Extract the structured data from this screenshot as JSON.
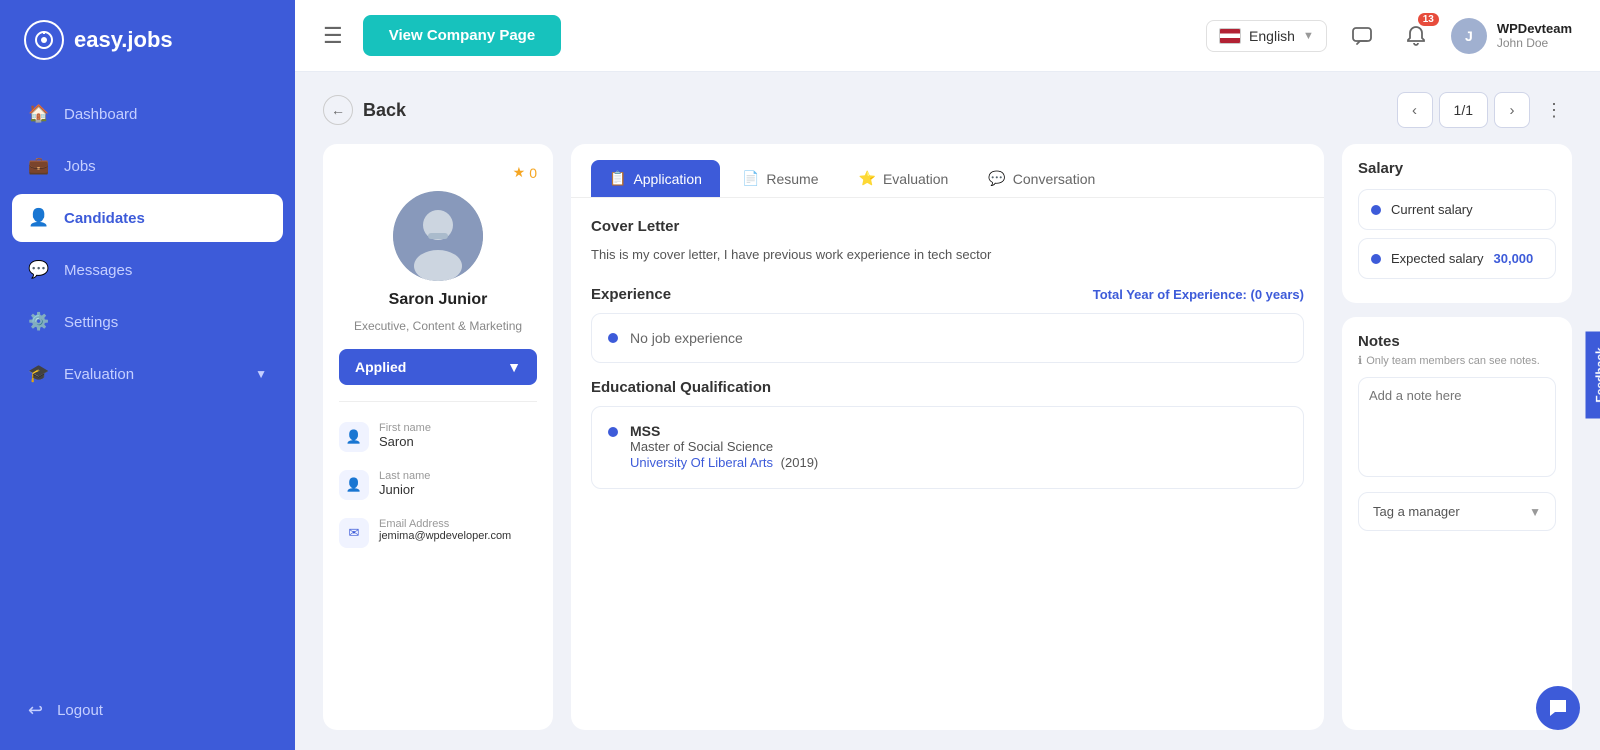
{
  "brand": {
    "name": "easy.jobs",
    "logo_char": "Q"
  },
  "sidebar": {
    "items": [
      {
        "id": "dashboard",
        "label": "Dashboard",
        "icon": "🏠"
      },
      {
        "id": "jobs",
        "label": "Jobs",
        "icon": "💼"
      },
      {
        "id": "candidates",
        "label": "Candidates",
        "icon": "👤",
        "active": true
      },
      {
        "id": "messages",
        "label": "Messages",
        "icon": "💬"
      },
      {
        "id": "settings",
        "label": "Settings",
        "icon": "⚙️"
      },
      {
        "id": "evaluation",
        "label": "Evaluation",
        "icon": "🎓",
        "has_arrow": true
      }
    ],
    "logout_label": "Logout"
  },
  "topbar": {
    "view_company_label": "View Company Page",
    "language": "English",
    "notification_count": "13",
    "user": {
      "company": "WPDevteam",
      "name": "John Doe"
    }
  },
  "back_label": "Back",
  "pagination": {
    "current": "1/1"
  },
  "candidate": {
    "name": "Saron Junior",
    "title": "Executive, Content & Marketing",
    "stars": "0",
    "status": "Applied",
    "first_name_label": "First name",
    "first_name": "Saron",
    "last_name_label": "Last name",
    "last_name": "Junior",
    "email_label": "Email Address",
    "email": "jemima@wpdeveloper.com"
  },
  "tabs": [
    {
      "id": "application",
      "label": "Application",
      "active": true
    },
    {
      "id": "resume",
      "label": "Resume",
      "active": false
    },
    {
      "id": "evaluation",
      "label": "Evaluation",
      "active": false
    },
    {
      "id": "conversation",
      "label": "Conversation",
      "active": false
    }
  ],
  "application": {
    "cover_letter_label": "Cover Letter",
    "cover_letter_text": "This is my cover letter, I have previous work experience in tech sector",
    "experience_label": "Experience",
    "total_years_label": "Total Year of Experience:",
    "total_years_value": "(0 years)",
    "no_experience": "No job experience",
    "education_label": "Educational Qualification",
    "education": {
      "degree": "MSS",
      "full_degree": "Master of Social Science",
      "university": "University Of Liberal Arts",
      "year": "(2019)"
    }
  },
  "salary": {
    "title": "Salary",
    "current_label": "Current salary",
    "expected_label": "Expected salary",
    "expected_amount": "30,000"
  },
  "notes": {
    "title": "Notes",
    "subtitle": "Only team members can see notes.",
    "placeholder": "Add a note here",
    "tag_label": "Tag a manager"
  },
  "feedback_label": "Feedback"
}
